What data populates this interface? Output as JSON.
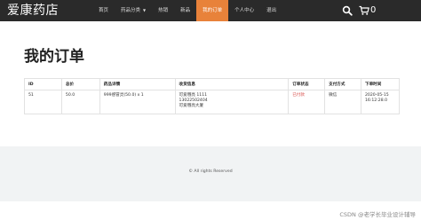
{
  "brand": "爱康药店",
  "nav": {
    "items": [
      {
        "label": "首页"
      },
      {
        "label": "药品分类"
      },
      {
        "label": "热销"
      },
      {
        "label": "新品"
      },
      {
        "label": "我的订单"
      },
      {
        "label": "个人中心"
      },
      {
        "label": "退出"
      }
    ],
    "active_index": 4,
    "cart_count": "0"
  },
  "page_title": "我的订单",
  "table": {
    "headers": [
      "ID",
      "总价",
      "药品详情",
      "收货信息",
      "订单状态",
      "支付方式",
      "下单时间"
    ],
    "rows": [
      {
        "id": "51",
        "total": "50.0",
        "detail": "999感冒灵(50.0) x 1",
        "receiver_name": "可爱哦亮 1111",
        "receiver_phone": "13022502404",
        "receiver_address": "可爱哦亮大厦",
        "status": "已付款",
        "payment": "微信",
        "time_date": "2020-05-15",
        "time_clock": "16:12:28.0"
      }
    ]
  },
  "footer": {
    "copyright": "© All rights Reserved"
  },
  "watermark": "CSDN @老学长毕业设计辅导",
  "colors": {
    "nav_bg": "#2a2a2a",
    "accent": "#e8823a",
    "status_red": "#d9534f",
    "footer_bg": "#f1f3f4"
  }
}
